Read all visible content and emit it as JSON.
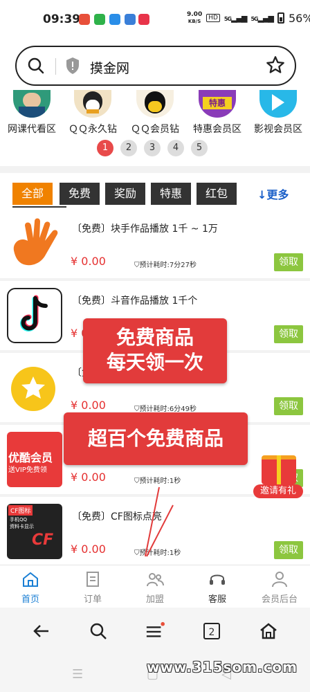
{
  "status_bar": {
    "time": "09:39",
    "net_speed_top": "9.00",
    "net_speed_bottom": "KB/S",
    "hd": "HD",
    "signal1": "5G",
    "signal2": "5G",
    "battery": "56%"
  },
  "search": {
    "text": "摸金网"
  },
  "categories": [
    {
      "label": "网课代看区"
    },
    {
      "label": "ＱＱ永久钻"
    },
    {
      "label": "ＱＱ会员钻"
    },
    {
      "label": "特惠会员区"
    },
    {
      "label": "影视会员区"
    }
  ],
  "category_badge_text": "特惠",
  "pager": [
    "1",
    "2",
    "3",
    "4",
    "5"
  ],
  "tabs": [
    "全部",
    "免费",
    "奖励",
    "特惠",
    "红包"
  ],
  "more_label": "更多",
  "products": [
    {
      "title": "〔免费〕块手作品播放 1千 ~ 1万",
      "price": "¥ 0.00",
      "eta": "预计耗时:7分27秒",
      "button": "领取"
    },
    {
      "title": "〔免费〕斗音作品播放 1千个",
      "price": "¥ 0.00",
      "eta": "",
      "button": "领取"
    },
    {
      "title": "〔免",
      "price": "¥ 0.00",
      "eta": "预计耗时:6分49秒",
      "button": "领取"
    },
    {
      "title": "",
      "price": "¥ 0.00",
      "eta": "预计耗时:1秒",
      "button": "领取"
    },
    {
      "title": "〔免费〕CF图标点亮",
      "price": "¥ 0.00",
      "eta": "预计耗时:1秒",
      "button": "领取"
    }
  ],
  "thumb_texts": {
    "youku_line1": "优酷会员",
    "youku_line2": "送VIP免费领",
    "cf_line1": "CF图标",
    "cf_line2": "手机QQ",
    "cf_line3": "资料卡显示",
    "cf_mark": "CF"
  },
  "overlays": {
    "free_line1": "免费商品",
    "free_line2": "每天领一次",
    "hundred": "超百个免费商品",
    "invite": "邀请有礼"
  },
  "bottom_nav": [
    {
      "label": "首页",
      "active": true
    },
    {
      "label": "订单",
      "active": false
    },
    {
      "label": "加盟",
      "active": false
    },
    {
      "label": "客服",
      "active": false
    },
    {
      "label": "会员后台",
      "active": false
    }
  ],
  "browser_tab_count": "2",
  "watermark": "www.315som.com",
  "colors": {
    "accent_orange": "#f08200",
    "price_red": "#e53030",
    "button_green": "#8cc63f",
    "overlay_red": "#e23b3b",
    "link_blue": "#1a5fc8"
  },
  "icons": [
    "search-icon",
    "shield-icon",
    "star-icon",
    "home-icon",
    "order-icon",
    "team-icon",
    "headset-icon",
    "user-icon",
    "back-arrow-icon",
    "menu-icon",
    "tabs-icon",
    "house-icon"
  ]
}
